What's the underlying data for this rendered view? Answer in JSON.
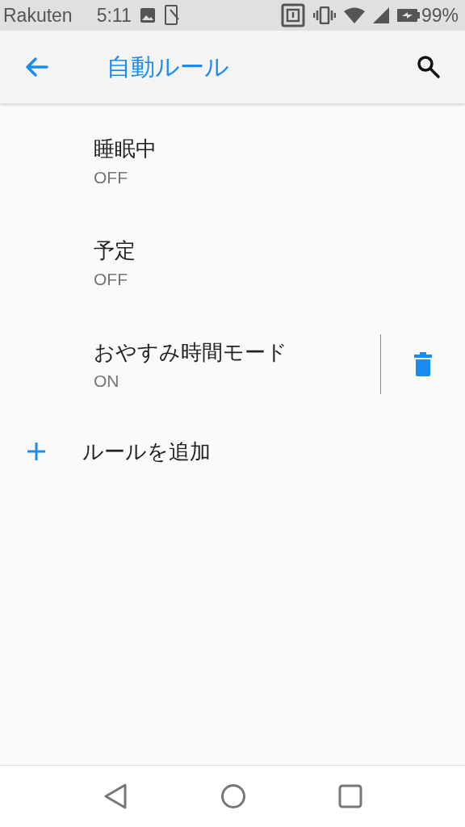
{
  "status_bar": {
    "carrier": "Rakuten",
    "time": "5:11",
    "battery": "99%"
  },
  "app_bar": {
    "title": "自動ルール"
  },
  "rules": [
    {
      "title": "睡眠中",
      "status": "OFF",
      "deletable": false
    },
    {
      "title": "予定",
      "status": "OFF",
      "deletable": false
    },
    {
      "title": "おやすみ時間モード",
      "status": "ON",
      "deletable": true
    }
  ],
  "add_rule": {
    "label": "ルールを追加"
  }
}
